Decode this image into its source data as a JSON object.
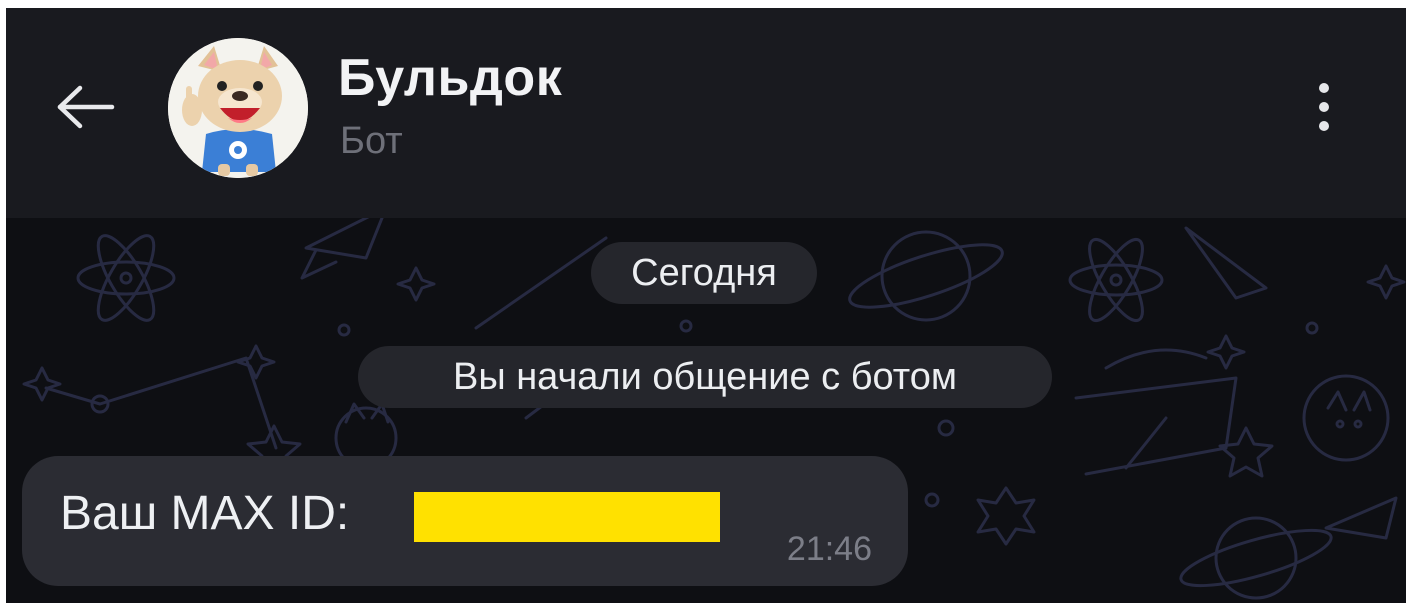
{
  "header": {
    "back_icon": "arrow-left-icon",
    "title": "Бульдок",
    "subtitle": "Бот",
    "avatar_icon": "bulldog-avatar",
    "menu_icon": "more-vertical-icon"
  },
  "chat": {
    "date_separator": "Сегодня",
    "service_message": "Вы начали общение с ботом",
    "messages": [
      {
        "text": "Ваш MAX ID:",
        "time": "21:46",
        "redacted": true
      }
    ]
  },
  "colors": {
    "header_bg": "#191a1f",
    "chat_bg": "#0e0f13",
    "bubble_bg": "#2b2c33",
    "pill_bg": "#25262c",
    "redaction": "#ffe100",
    "wallpaper_line": "#2b2f4a"
  }
}
